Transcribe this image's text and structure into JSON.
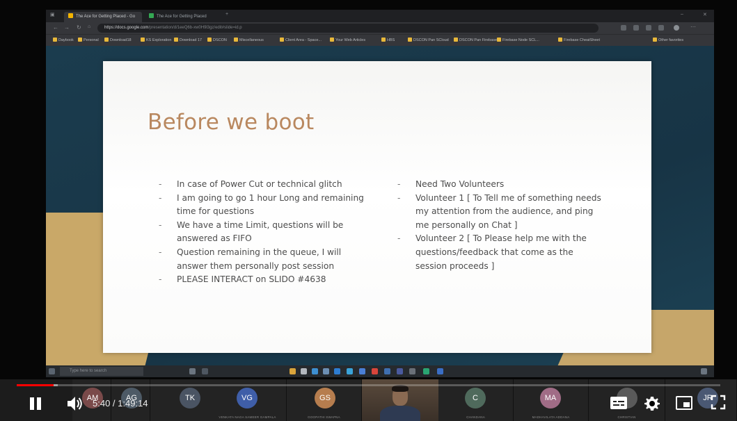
{
  "browser": {
    "tabs": [
      {
        "label": "The Ace for Getting Placed - Go"
      },
      {
        "label": "The Ace for Getting Placed"
      }
    ],
    "url": "https://docs.google.com",
    "url_rest": "/presentation/d/1eeQ6b-xw0H9l3gz/edit#slide=id.p",
    "bookmarks": [
      "Daybook",
      "Personal",
      "Download18",
      "KS Exploration",
      "Download 17",
      "DSCON",
      "Miscellaneous",
      "Client Area - Space...",
      "Your Web Articles",
      "HBS",
      "DSCON Pan SCloud",
      "DSCON Pan Firebase",
      "Firebase Node SCL...",
      "Firebase CheatSheet",
      "Other favorites"
    ]
  },
  "slide": {
    "title": "Before we boot",
    "left_bullets": [
      "In case of Power Cut or technical glitch",
      "I am going to go 1 hour Long and remaining time for questions",
      "We have a time Limit, questions will be answered as FIFO",
      "Question remaining in the queue, I will answer them personally post session",
      "PLEASE INTERACT on SLIDO #4638"
    ],
    "right_bullets": [
      "Need Two Volunteers",
      "Volunteer 1 [ To Tell me of something needs my attention from the audience, and ping me personally on Chat ]",
      "Volunteer 2 [ To Please help me with the questions/feedback that come as the session proceeds ]"
    ]
  },
  "taskbar": {
    "search_placeholder": "Type here to search"
  },
  "participants": [
    {
      "initials": "AM",
      "color": "#7a4a4a",
      "name": ""
    },
    {
      "initials": "AG",
      "color": "#4d5a66",
      "name": ""
    },
    {
      "initials": "TK",
      "color": "#4a5463",
      "name": ""
    },
    {
      "initials": "VG",
      "color": "#3f5ea8",
      "name": "VENKATA NAGA SAMEER GAMPALA"
    },
    {
      "initials": "GS",
      "color": "#b67d4e",
      "name": "GOOPATHI SWAPNA"
    },
    {
      "initials": "C",
      "color": "#4f6a5c",
      "name": "CHANDANA"
    },
    {
      "initials": "MA",
      "color": "#a06c86",
      "name": "MADHAVILATA ADDANA"
    },
    {
      "initials": "",
      "color": "#5a5a5a",
      "name": "CHRISTIAN"
    },
    {
      "initials": "JR",
      "color": "#4a5873",
      "name": ""
    }
  ],
  "player": {
    "current_time": "5:40",
    "duration": "1:49:14",
    "time_separator": " / ",
    "progress_fraction": 0.052,
    "buffered_fraction": 0.058,
    "accent_color": "#ff0000"
  }
}
